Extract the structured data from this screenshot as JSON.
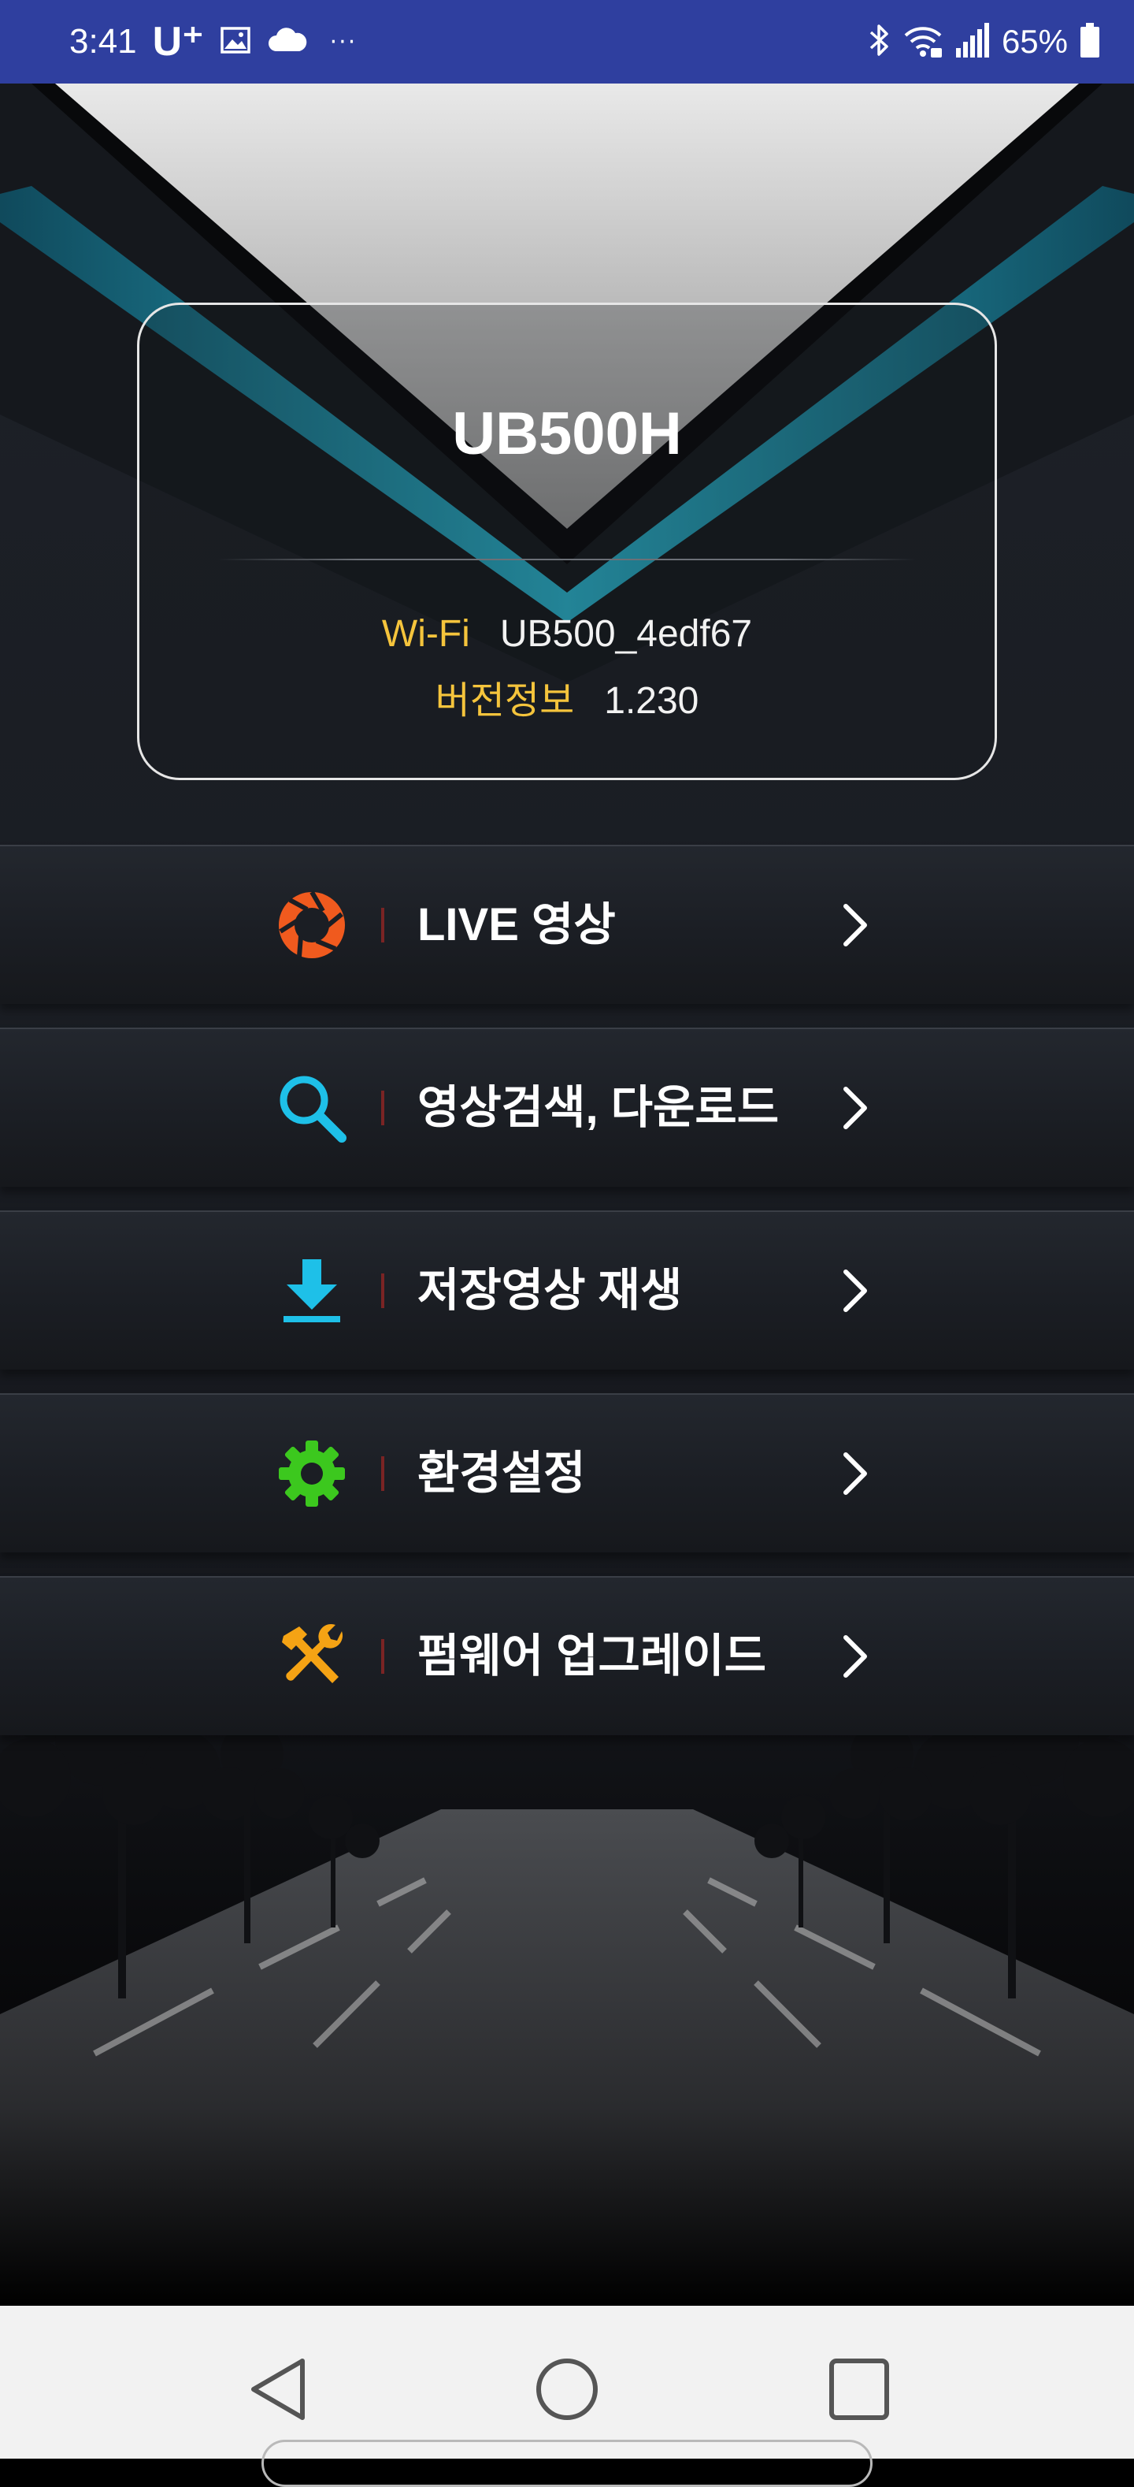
{
  "status_bar": {
    "time": "3:41",
    "carrier": "U⁺",
    "notification_icons": [
      "image-icon",
      "cloud-icon"
    ],
    "more": "···",
    "system_icons": [
      "bluetooth-icon",
      "wifi-icon",
      "signal-icon",
      "battery-icon"
    ],
    "battery_percent": "65%"
  },
  "device": {
    "name": "UB500H",
    "wifi_label": "Wi-Fi",
    "wifi_value": "UB500_4edf67",
    "version_label": "버전정보",
    "version_value": "1.230"
  },
  "menu": {
    "items": [
      {
        "label": "LIVE 영상",
        "icon": "camera-shutter-icon",
        "icon_color": "#f05a1e"
      },
      {
        "label": "영상검색, 다운로드",
        "icon": "search-icon",
        "icon_color": "#1ec0e8"
      },
      {
        "label": "저장영상 재생",
        "icon": "download-icon",
        "icon_color": "#1ec0e8"
      },
      {
        "label": "환경설정",
        "icon": "gear-icon",
        "icon_color": "#3cc81e"
      },
      {
        "label": "펌웨어 업그레이드",
        "icon": "tools-icon",
        "icon_color": "#f5a314"
      }
    ]
  },
  "nav_bar": {
    "buttons": [
      "back-icon",
      "home-icon",
      "recent-apps-icon"
    ]
  },
  "colors": {
    "status_bar": "#2f3f9f",
    "accent_label": "#f5c43c",
    "teal_stripe": "#22b3cc",
    "separator": "#7a2424"
  }
}
